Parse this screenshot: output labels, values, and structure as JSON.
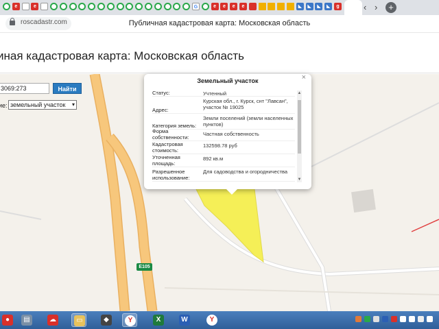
{
  "browser": {
    "url": "roscadastr.com",
    "window_title": "Публичная кадастровая карта: Московская область",
    "tab_icons": [
      "green-check",
      "red-letter",
      "white-doc",
      "red-letter",
      "white-doc",
      "green-o",
      "green-o",
      "green-o",
      "green-o",
      "green-o",
      "green-o",
      "green-o",
      "green-o",
      "green-o",
      "green-o",
      "green-o",
      "green-o",
      "green-o",
      "green-o",
      "green-o",
      "google-icon",
      "green-o",
      "red-letter",
      "red-letter",
      "red-letter",
      "red-letter",
      "shield-icon",
      "envelope-icon",
      "envelope-icon",
      "envelope-icon",
      "envelope-icon",
      "blue-arrow-icon",
      "blue-arrow-icon",
      "blue-arrow-icon",
      "blue-arrow-icon",
      "red-g-icon"
    ],
    "nav_prev": "‹",
    "nav_next": "›",
    "new_tab": "+"
  },
  "page": {
    "heading": "иная кадастровая карта: Московская область"
  },
  "search": {
    "input_value": "3069:273",
    "button_label": "Найти",
    "type_label": "ие:",
    "type_value": "земельный участок"
  },
  "map": {
    "road_sign": "E105"
  },
  "popup": {
    "title": "Земельный участок",
    "close": "×",
    "rows": [
      {
        "key": "Статус:",
        "value": "Учтенный"
      },
      {
        "key": "Адрес:",
        "value": "Курская обл., г. Курск, снт \"Лавсан\", участок № 19025"
      },
      {
        "key": "Категория земель:",
        "value": "Земли поселений (земли населенных пунктов)"
      },
      {
        "key": "Форма собственности:",
        "value": "Частная собственность"
      },
      {
        "key": "Кадастровая стоимость:",
        "value": "132598.78 руб"
      },
      {
        "key": "Уточненная площадь:",
        "value": "892 кв.м"
      },
      {
        "key": "Разрешенное использование:",
        "value": "Для садоводства и огородничества"
      }
    ]
  },
  "taskbar": {
    "apps": [
      "app-icon-red",
      "printer-icon",
      "cloud-icon",
      "folder-icon",
      "media-icon",
      "yandex-browser-icon",
      "excel-icon",
      "word-icon",
      "yandex-browser-icon"
    ]
  }
}
